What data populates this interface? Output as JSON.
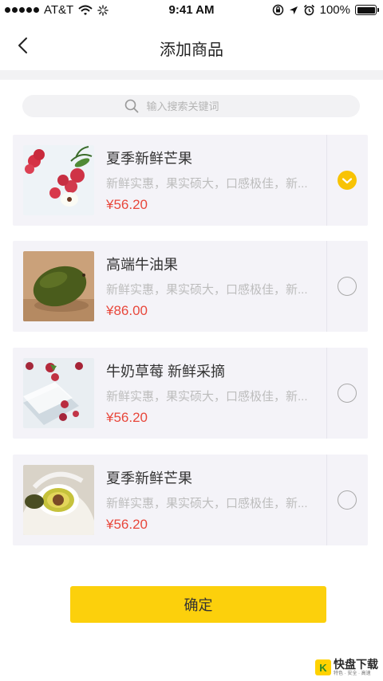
{
  "status_bar": {
    "carrier": "AT&T",
    "time": "9:41 AM",
    "battery": "100%",
    "battery_level": 1.0
  },
  "nav": {
    "title": "添加商品",
    "back_icon": "chevron-left-icon"
  },
  "search": {
    "placeholder": "输入搜索关键词",
    "icon": "search-icon"
  },
  "products": [
    {
      "title": "夏季新鲜芒果",
      "desc": "新鲜实惠，果实硕大，口感极佳，新...",
      "price": "¥56.20",
      "selected": true
    },
    {
      "title": "高端牛油果",
      "desc": "新鲜实惠，果实硕大，口感极佳，新...",
      "price": "¥86.00",
      "selected": false
    },
    {
      "title": "牛奶草莓 新鲜采摘",
      "desc": "新鲜实惠，果实硕大，口感极佳，新...",
      "price": "¥56.20",
      "selected": false
    },
    {
      "title": "夏季新鲜芒果",
      "desc": "新鲜实惠，果实硕大，口感极佳，新...",
      "price": "¥56.20",
      "selected": false
    }
  ],
  "confirm_label": "确定",
  "watermark": {
    "badge": "K",
    "main": "快盘下载",
    "sub": "特色 · 安全 · 高速"
  },
  "colors": {
    "accent": "#fcd00c",
    "price": "#e8473b",
    "card_bg": "#f4f3f8"
  }
}
